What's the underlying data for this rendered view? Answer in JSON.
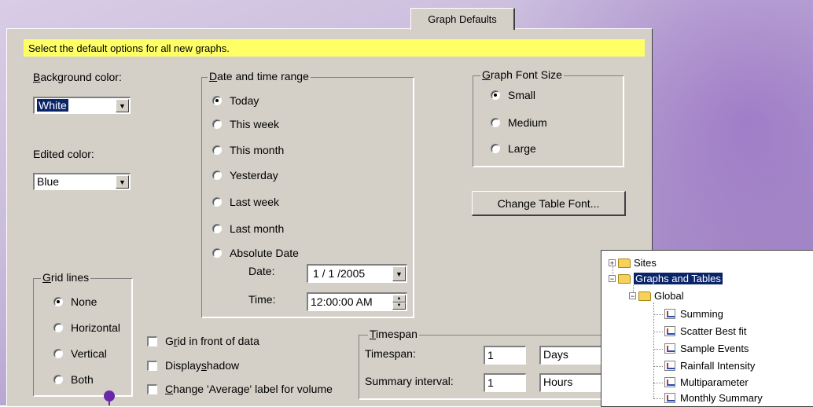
{
  "tab": {
    "label": "Graph Defaults"
  },
  "instruction": "Select the default options for all new graphs.",
  "background_color": {
    "label_pre": "",
    "label_ul": "B",
    "label_post": "ackground color:",
    "value": "White"
  },
  "edited_color": {
    "label": "Edited color:",
    "value": "Blue"
  },
  "date_range": {
    "legend_ul": "D",
    "legend_post": "ate and time range",
    "options": [
      "Today",
      "This week",
      "This month",
      "Yesterday",
      "Last week",
      "Last month",
      "Absolute Date"
    ],
    "selected": 0,
    "date_label": "Date:",
    "date_value": "1 / 1 /2005",
    "time_label": "Time:",
    "time_value": "12:00:00 AM"
  },
  "font_size": {
    "legend_ul": "G",
    "legend_post": "raph Font Size",
    "options": [
      "Small",
      "Medium",
      "Large"
    ],
    "selected": 0
  },
  "change_table_font": "Change Table Font...",
  "grid_lines": {
    "legend_ul": "G",
    "legend_post": "rid lines",
    "options": [
      "None",
      "Horizontal",
      "Vertical",
      "Both"
    ],
    "selected": 0
  },
  "checkboxes": {
    "grid_front": {
      "pre": "G",
      "ul": "r",
      "post": "id in front of data"
    },
    "display_shadow": {
      "pre": "Display ",
      "ul": "s",
      "post": "hadow"
    },
    "change_average": {
      "pre": "",
      "ul": "C",
      "post": "hange 'Average' label for volume"
    }
  },
  "timespan": {
    "legend_ul": "T",
    "legend_post": "imespan",
    "timespan_label": "Timespan:",
    "timespan_value": "1",
    "timespan_unit": "Days",
    "summary_label": "Summary interval:",
    "summary_value": "1",
    "summary_unit": "Hours"
  },
  "tree": {
    "sites": "Sites",
    "graphs_tables": "Graphs and Tables",
    "global": "Global",
    "items": [
      "Summing",
      "Scatter Best fit",
      "Sample Events",
      "Rainfall Intensity",
      "Multiparameter",
      "Monthly Summary"
    ]
  },
  "colors": {
    "accent": "#ffff66",
    "selection": "#0a246a",
    "dialog": "#d4d0c8",
    "marker": "#6a28a8"
  }
}
